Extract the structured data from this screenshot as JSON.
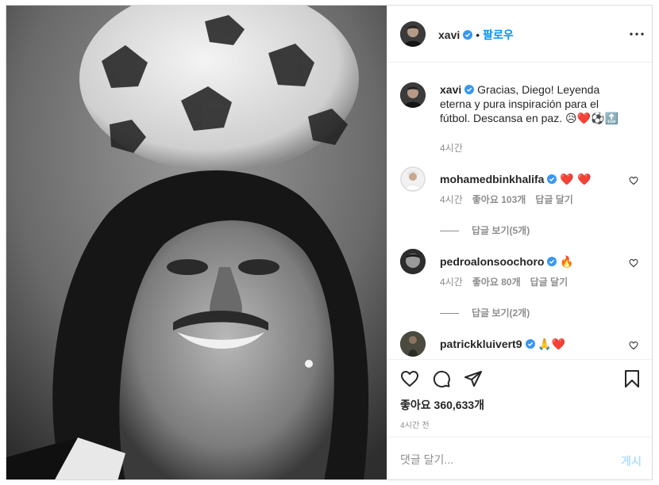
{
  "header": {
    "username": "xavi",
    "separator": "•",
    "follow_label": "팔로우",
    "more_icon": "more-horizontal-icon"
  },
  "caption": {
    "username": "xavi",
    "text": "Gracias, Diego! Leyenda eterna y pura inspiración para el fútbol. Descansa en paz.",
    "emojis": "😥❤️⚽🔝",
    "time": "4시간"
  },
  "comments": [
    {
      "username": "mohamedbinkhalifa",
      "text": "",
      "emojis": "❤️ ❤️",
      "time": "4시간",
      "likes": "좋아요 103개",
      "reply_label": "답글 달기",
      "view_replies": "답글 보기(5개)"
    },
    {
      "username": "pedroalonsoochoro",
      "text": "",
      "emojis": "🔥",
      "time": "4시간",
      "likes": "좋아요 80개",
      "reply_label": "답글 달기",
      "view_replies": "답글 보기(2개)"
    },
    {
      "username": "patrickkluivert9",
      "text": "",
      "emojis": "🙏❤️",
      "time": "",
      "likes": "",
      "reply_label": "",
      "view_replies": ""
    }
  ],
  "actions": {
    "like_icon": "heart-icon",
    "comment_icon": "comment-icon",
    "share_icon": "paper-plane-icon",
    "save_icon": "bookmark-icon",
    "likes_count": "좋아요 360,633개",
    "timestamp": "4시간 전"
  },
  "add_comment": {
    "placeholder": "댓글 달기...",
    "post_label": "게시"
  },
  "colors": {
    "link_blue": "#0095f6",
    "post_disabled": "#b2dffc",
    "secondary_text": "#8e8e8e",
    "border": "#dbdbdb",
    "heart_red": "#ed4956"
  }
}
